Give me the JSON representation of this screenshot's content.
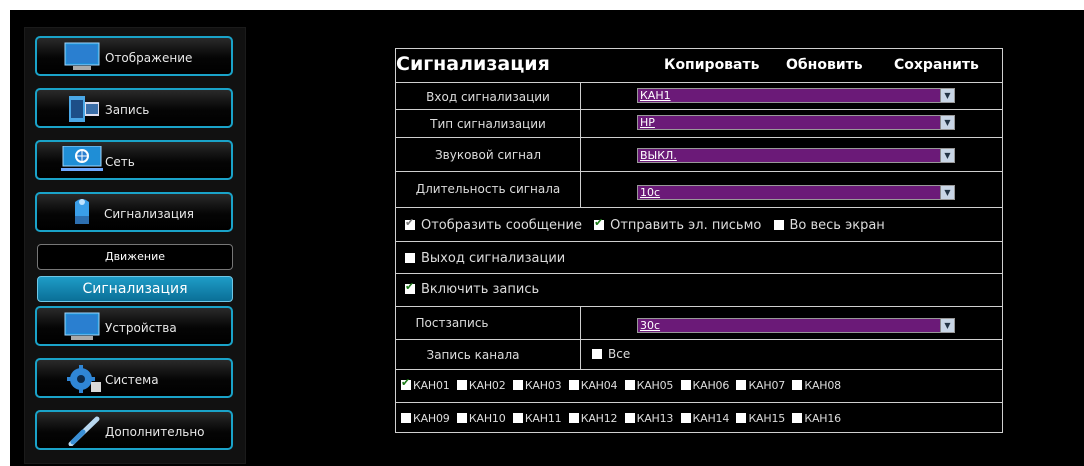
{
  "sidebar": {
    "items": [
      {
        "label": "Отображение",
        "icon": "monitor-icon"
      },
      {
        "label": "Запись",
        "icon": "film-icon"
      },
      {
        "label": "Сеть",
        "icon": "network-globe-icon"
      },
      {
        "label": "Сигнализация",
        "icon": "alarm-siren-icon"
      },
      {
        "label": "Устройства",
        "icon": "device-monitor-icon"
      },
      {
        "label": "Система",
        "icon": "gear-icon"
      },
      {
        "label": "Дополнительно",
        "icon": "tools-icon"
      }
    ],
    "subitems": [
      {
        "label": "Движение",
        "active": false
      },
      {
        "label": "Сигнализация",
        "active": true
      }
    ]
  },
  "panel": {
    "title": "Сигнализация",
    "copy_label": "Копировать",
    "refresh_label": "Обновить",
    "save_label": "Сохранить",
    "alarm_input": {
      "label": "Вход сигнализации",
      "value": "КАН1"
    },
    "alarm_type": {
      "label": "Тип сигнализации",
      "value": "НР"
    },
    "sound": {
      "label": "Звуковой сигнал",
      "value": "ВЫКЛ."
    },
    "duration": {
      "label": "Длительность сигнала",
      "value": "10с"
    },
    "show_message": {
      "label": "Отобразить сообщение",
      "checked": true
    },
    "send_email": {
      "label": "Отправить эл. письмо",
      "checked": true
    },
    "fullscreen": {
      "label": "Во весь экран",
      "checked": false
    },
    "alarm_output": {
      "label": "Выход сигнализации",
      "checked": false
    },
    "enable_record": {
      "label": "Включить запись",
      "checked": true
    },
    "post_record": {
      "label": "Постзапись",
      "value": "30с"
    },
    "channel_record": {
      "label": "Запись канала",
      "all_label": "Все",
      "all_checked": false
    },
    "channels_row1": [
      {
        "label": "КАН01",
        "checked": true
      },
      {
        "label": "КАН02",
        "checked": false
      },
      {
        "label": "КАН03",
        "checked": false
      },
      {
        "label": "КАН04",
        "checked": false
      },
      {
        "label": "КАН05",
        "checked": false
      },
      {
        "label": "КАН06",
        "checked": false
      },
      {
        "label": "КАН07",
        "checked": false
      },
      {
        "label": "КАН08",
        "checked": false
      }
    ],
    "channels_row2": [
      {
        "label": "КАН09",
        "checked": false
      },
      {
        "label": "КАН10",
        "checked": false
      },
      {
        "label": "КАН11",
        "checked": false
      },
      {
        "label": "КАН12",
        "checked": false
      },
      {
        "label": "КАН13",
        "checked": false
      },
      {
        "label": "КАН14",
        "checked": false
      },
      {
        "label": "КАН15",
        "checked": false
      },
      {
        "label": "КАН16",
        "checked": false
      }
    ]
  },
  "colors": {
    "accent": "#1aa3c9",
    "dropdown_bg": "#6b1a78",
    "background": "#000000"
  }
}
